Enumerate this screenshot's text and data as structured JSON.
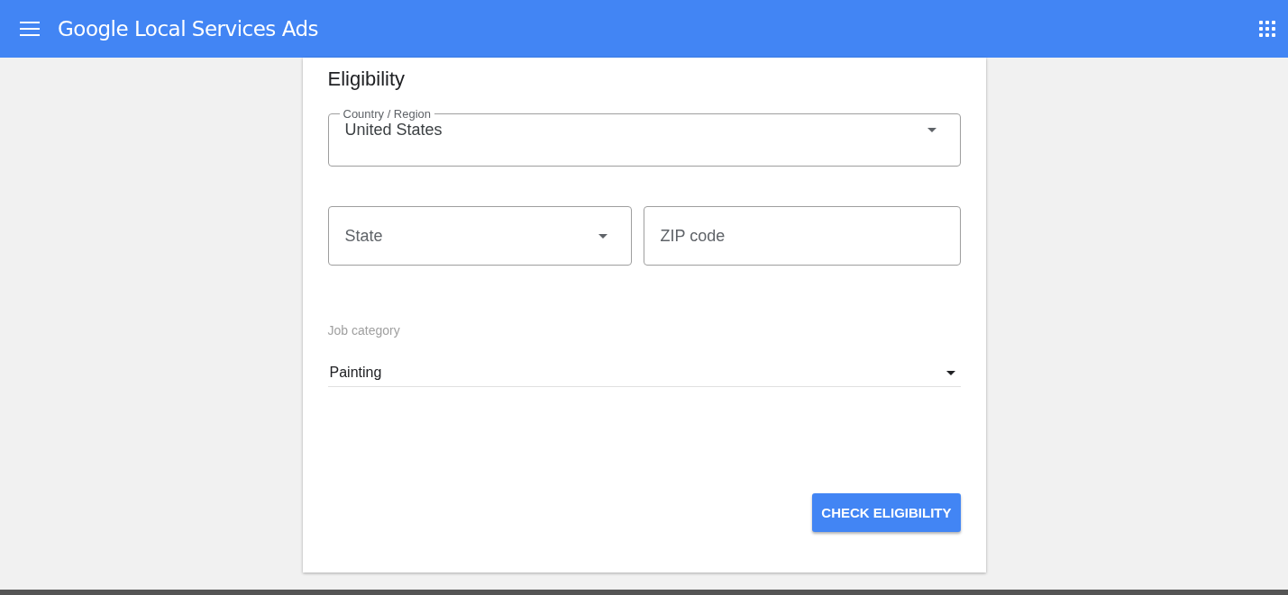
{
  "app_bar": {
    "title": "Google Local Services Ads"
  },
  "form": {
    "heading": "Eligibility",
    "country": {
      "label": "Country / Region",
      "value": "United States"
    },
    "state": {
      "placeholder": "State"
    },
    "zip": {
      "placeholder": "ZIP code"
    },
    "job_category": {
      "label": "Job category",
      "value": "Painting"
    },
    "submit": "CHECK ELIGIBILITY"
  }
}
